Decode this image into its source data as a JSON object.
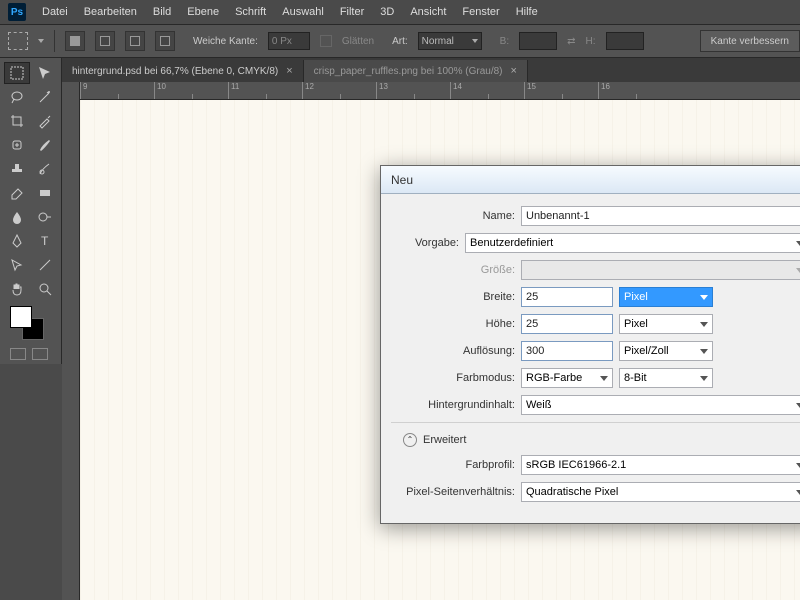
{
  "menu": {
    "items": [
      "Datei",
      "Bearbeiten",
      "Bild",
      "Ebene",
      "Schrift",
      "Auswahl",
      "Filter",
      "3D",
      "Ansicht",
      "Fenster",
      "Hilfe"
    ]
  },
  "options": {
    "soft_edge_label": "Weiche Kante:",
    "soft_edge_value": "0 Px",
    "anti_alias_label": "Glätten",
    "style_label": "Art:",
    "style_value": "Normal",
    "width_label": "B:",
    "height_label": "H:",
    "refine_edge_label": "Kante verbessern"
  },
  "tabs": [
    {
      "label": "hintergrund.psd bei 66,7% (Ebene 0, CMYK/8)",
      "active": true
    },
    {
      "label": "crisp_paper_ruffles.png bei 100% (Grau/8)",
      "active": false
    }
  ],
  "ruler": {
    "ticks": [
      "9",
      "10",
      "11",
      "12",
      "13",
      "14",
      "15",
      "16"
    ]
  },
  "dialog": {
    "title": "Neu",
    "name_label": "Name:",
    "name_value": "Unbenannt-1",
    "preset_label": "Vorgabe:",
    "preset_value": "Benutzerdefiniert",
    "size_label": "Größe:",
    "width_label": "Breite:",
    "width_value": "25",
    "width_unit": "Pixel",
    "height_label": "Höhe:",
    "height_value": "25",
    "height_unit": "Pixel",
    "resolution_label": "Auflösung:",
    "resolution_value": "300",
    "resolution_unit": "Pixel/Zoll",
    "colormode_label": "Farbmodus:",
    "colormode_value": "RGB-Farbe",
    "depth_value": "8-Bit",
    "bg_label": "Hintergrundinhalt:",
    "bg_value": "Weiß",
    "advanced_label": "Erweitert",
    "profile_label": "Farbprofil:",
    "profile_value": "sRGB IEC61966-2.1",
    "aspect_label": "Pixel-Seitenverhältnis:",
    "aspect_value": "Quadratische Pixel"
  }
}
